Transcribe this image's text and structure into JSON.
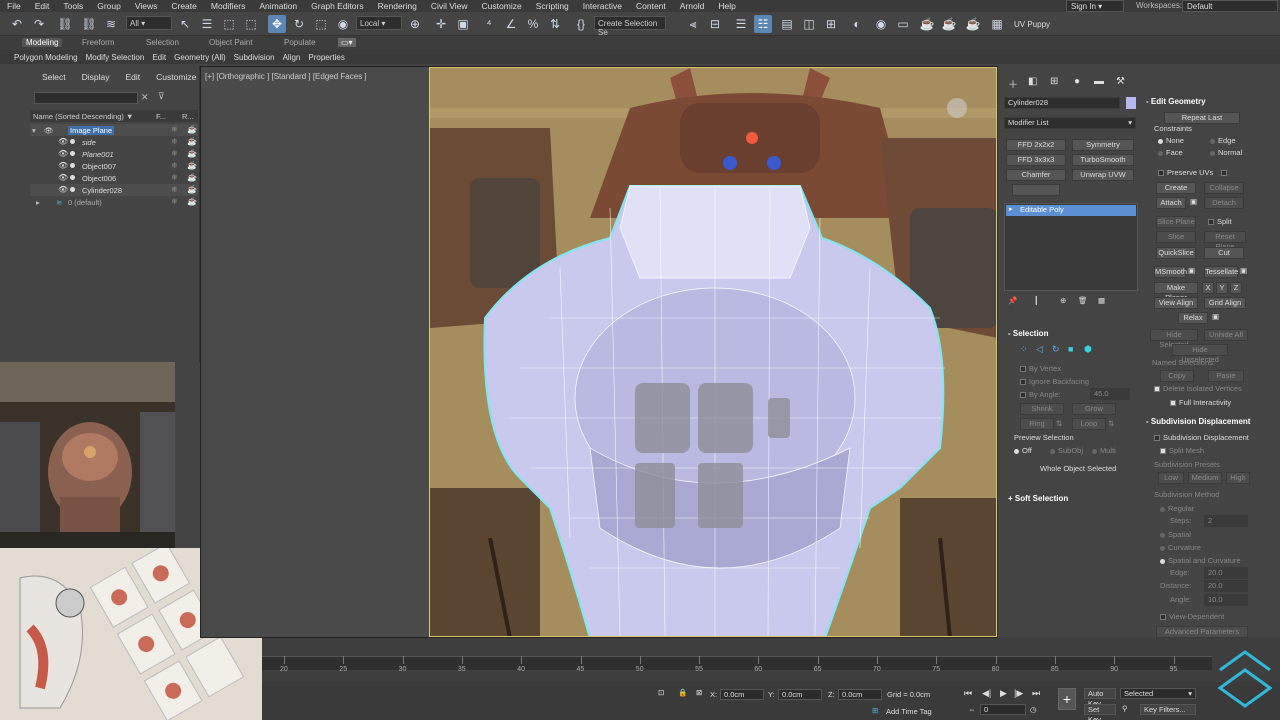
{
  "menubar": {
    "items": [
      "File",
      "Edit",
      "Tools",
      "Group",
      "Views",
      "Create",
      "Modifiers",
      "Animation",
      "Graph Editors",
      "Rendering",
      "Civil View",
      "Customize",
      "Scripting",
      "Interactive",
      "Content",
      "Arnold",
      "Help"
    ],
    "sign_in": "Sign In",
    "workspaces_label": "Workspaces:",
    "workspace_value": "Default"
  },
  "toolbar": {
    "selection_filter": "All",
    "reference_coord": "Local",
    "named_selection_placeholder": "Create Selection Se",
    "uv_label": "UV Puppy"
  },
  "ribbon": {
    "tabs": [
      "Modeling",
      "Freeform",
      "Selection",
      "Object Paint",
      "Populate"
    ],
    "active_tab": "Modeling",
    "subtabs": [
      "Polygon Modeling",
      "Modify Selection",
      "Edit",
      "Geometry (All)",
      "Subdivision",
      "Align",
      "Properties"
    ]
  },
  "explorer": {
    "tabs": [
      "Select",
      "Display",
      "Edit",
      "Customize"
    ],
    "column_name": "Name (Sorted Descending)",
    "column_f": "F...",
    "column_r": "R...",
    "rows": [
      {
        "label": "Image Plane",
        "indent": 0,
        "selected": true
      },
      {
        "label": "side",
        "indent": 1
      },
      {
        "label": "Plane001",
        "indent": 1
      },
      {
        "label": "Object007",
        "indent": 1
      },
      {
        "label": "Object006",
        "indent": 1
      },
      {
        "label": "Cylinder028",
        "indent": 1,
        "highlighted": true
      },
      {
        "label": "0 (default)",
        "indent": 0
      }
    ]
  },
  "viewport": {
    "label": "[+] [Orthographic ] [Standard ] [Edged Faces ]"
  },
  "command_panel": {
    "object_name": "Cylinder028",
    "modifier_list": "Modifier List",
    "modifier_buttons": [
      "FFD 2x2x2",
      "Symmetry",
      "FFD 3x3x3",
      "TurboSmooth",
      "Chamfer",
      "Unwrap UVW"
    ],
    "stack_item": "Editable Poly",
    "selection_header": "Selection",
    "by_vertex": "By Vertex",
    "ignore_backfacing": "Ignore Backfacing",
    "by_angle": "By Angle:",
    "by_angle_value": "45.0",
    "shrink": "Shrink",
    "grow": "Grow",
    "ring": "Ring",
    "loop": "Loop",
    "preview_selection": "Preview Selection",
    "preview_off": "Off",
    "preview_subobj": "SubObj",
    "preview_multi": "Multi",
    "whole_object_selected": "Whole Object Selected",
    "soft_selection": "Soft Selection",
    "edit_geometry": "Edit Geometry",
    "repeat_last": "Repeat Last",
    "constraints": "Constraints",
    "c_none": "None",
    "c_edge": "Edge",
    "c_face": "Face",
    "c_normal": "Normal",
    "preserve_uvs": "Preserve UVs",
    "create": "Create",
    "collapse": "Collapse",
    "attach": "Attach",
    "detach": "Detach",
    "slice_plane": "Slice Plane",
    "split": "Split",
    "slice": "Slice",
    "reset_plane": "Reset Plane",
    "quickslice": "QuickSlice",
    "cut": "Cut",
    "msmooth": "MSmooth",
    "tessellate": "Tessellate",
    "make_planar": "Make Planar",
    "x": "X",
    "y": "Y",
    "z": "Z",
    "view_align": "View Align",
    "grid_align": "Grid Align",
    "relax": "Relax",
    "hide_selected": "Hide Selected",
    "unhide_all": "Unhide All",
    "hide_unselected": "Hide Unselected",
    "named_selections": "Named Selections:",
    "copy": "Copy",
    "paste": "Paste",
    "delete_isolated": "Delete Isolated Vertices",
    "full_interactivity": "Full Interactivity",
    "subdivision_displacement_header": "Subdivision Displacement",
    "subdivision_displacement": "Subdivision Displacement",
    "split_mesh": "Split Mesh",
    "subdivision_presets": "Subdivision Presets",
    "low": "Low",
    "medium": "Medium",
    "high": "High",
    "subdivision_method": "Subdivision Method",
    "regular": "Regular",
    "steps": "Steps:",
    "steps_value": "2",
    "spatial": "Spatial",
    "curvature": "Curvature",
    "spatial_curvature": "Spatial and Curvature",
    "edge": "Edge:",
    "edge_value": "20.0",
    "distance": "Distance:",
    "distance_value": "20.0",
    "angle": "Angle:",
    "angle_value": "10.0",
    "view_dependent": "View-Dependent",
    "advanced_parameters": "Advanced Parameters"
  },
  "timeline": {
    "ticks": [
      "20",
      "25",
      "30",
      "35",
      "40",
      "45",
      "50",
      "55",
      "60",
      "65",
      "70",
      "75",
      "80",
      "85",
      "90",
      "95"
    ]
  },
  "statusbar": {
    "x_label": "X:",
    "x_value": "0.0cm",
    "y_label": "Y:",
    "y_value": "0.0cm",
    "z_label": "Z:",
    "z_value": "0.0cm",
    "grid": "Grid = 0.0cm",
    "add_time_tag": "Add Time Tag",
    "frame_value": "0",
    "auto_key": "Auto Key",
    "auto_key_value": "Selected",
    "set_key": "Set Key",
    "key_filters": "Key Filters..."
  },
  "colors": {
    "accent": "#5c86b4",
    "selection_outline": "#7fe6f2",
    "mesh": "#c9c9ee"
  }
}
